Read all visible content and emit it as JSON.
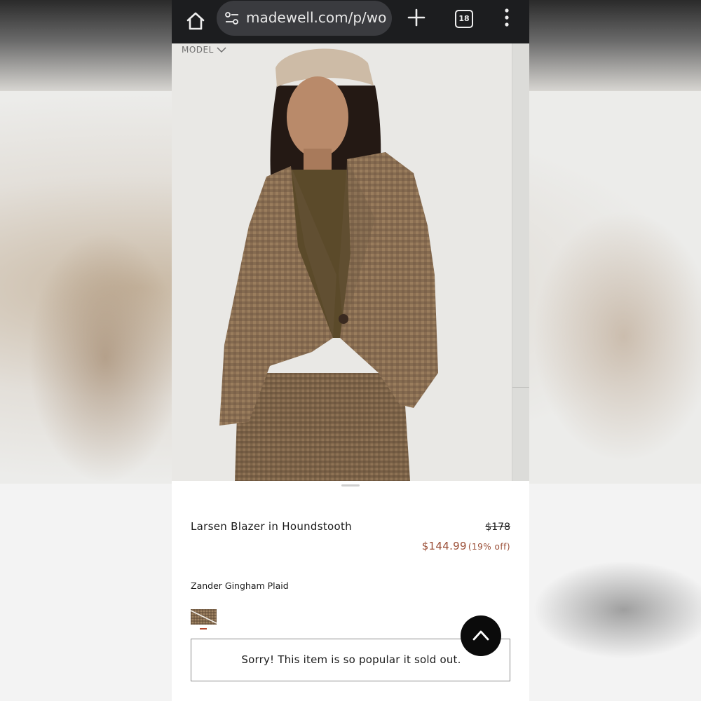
{
  "browser": {
    "url": "madewell.com/p/wor",
    "tab_count": "18"
  },
  "gallery": {
    "model_label": "MODEL"
  },
  "product": {
    "title": "Larsen Blazer in Houndstooth",
    "original_price": "$178",
    "sale_price": "$144.99",
    "discount": "(19% off)",
    "color_name": "Zander Gingham Plaid",
    "soldout_message": "Sorry! This item is so popular it sold out."
  },
  "colors": {
    "sale": "#9a4d35",
    "swatch_selected": "#b4482e",
    "browser_bar": "#1c1d1f"
  },
  "icons": {
    "home": "home-icon",
    "site_settings": "site-settings-icon",
    "new_tab": "plus-icon",
    "tabs": "tabs-icon",
    "menu": "more-vert-icon",
    "dropdown": "chevron-down-icon",
    "scroll_top": "chevron-up-icon"
  }
}
